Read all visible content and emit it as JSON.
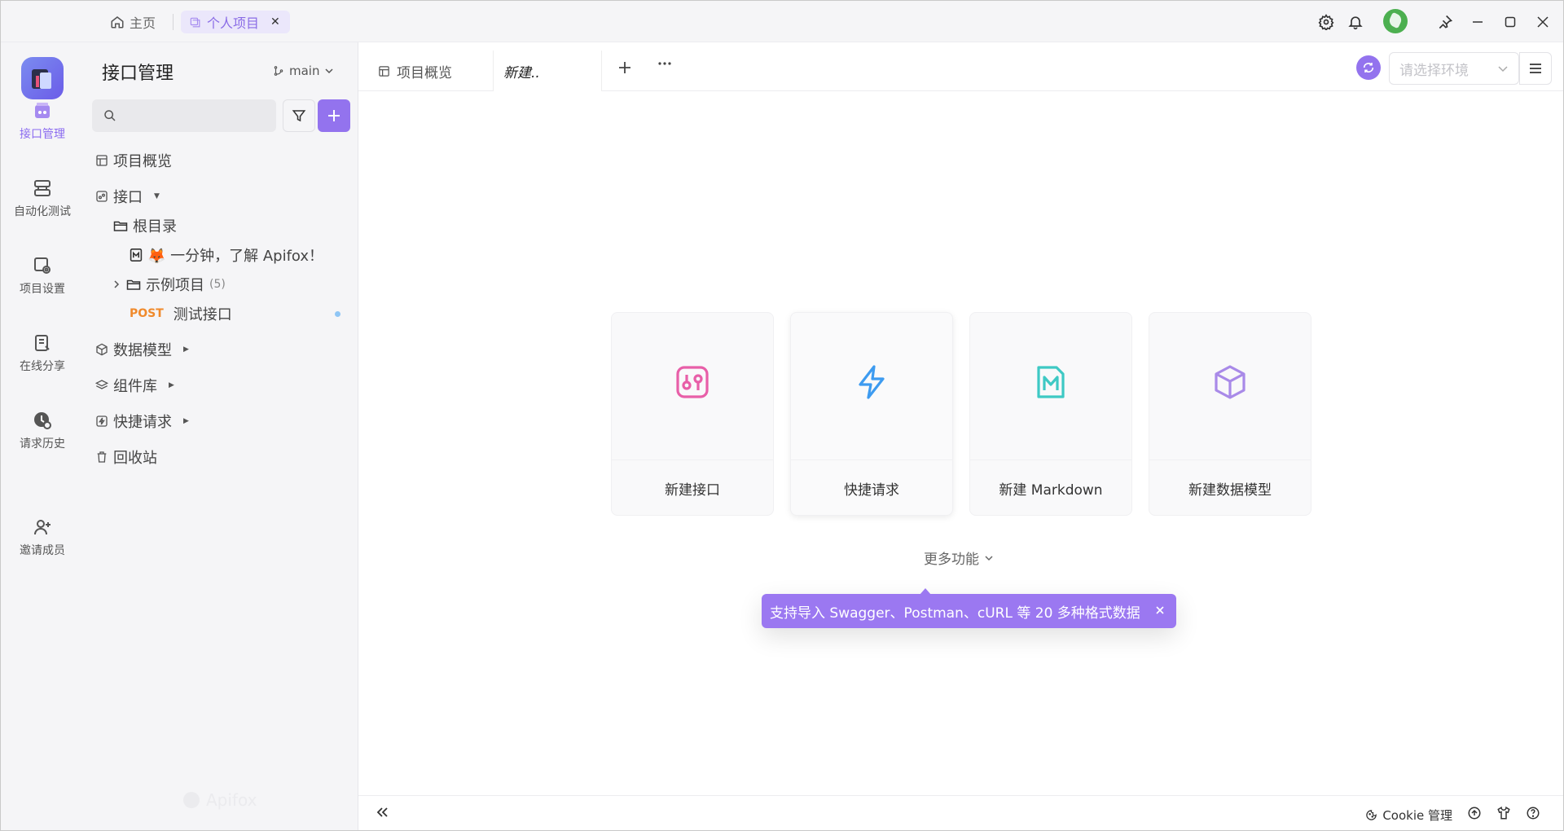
{
  "titlebar": {
    "home_label": "主页",
    "project_tab_label": "个人项目",
    "close_glyph": "✕"
  },
  "rail": {
    "items": [
      {
        "label": "接口管理",
        "icon": "api-manage-icon",
        "active": true
      },
      {
        "label": "自动化测试",
        "icon": "automation-icon",
        "active": false
      },
      {
        "label": "项目设置",
        "icon": "project-settings-icon",
        "active": false
      },
      {
        "label": "在线分享",
        "icon": "online-share-icon",
        "active": false
      },
      {
        "label": "请求历史",
        "icon": "request-history-icon",
        "active": false
      },
      {
        "label": "邀请成员",
        "icon": "invite-member-icon",
        "active": false
      }
    ]
  },
  "sidebar": {
    "title": "接口管理",
    "branch": "main",
    "search_placeholder": "",
    "tree": [
      {
        "label": "项目概览"
      },
      {
        "label": "接口"
      },
      {
        "label": "根目录"
      },
      {
        "label": "🦊 一分钟，了解 Apifox！"
      },
      {
        "label": "示例项目",
        "count": "(5)"
      },
      {
        "method": "POST",
        "label": "测试接口"
      },
      {
        "label": "数据模型"
      },
      {
        "label": "组件库"
      },
      {
        "label": "快捷请求"
      },
      {
        "label": "回收站"
      }
    ],
    "watermark": "Apifox"
  },
  "main": {
    "tabs": [
      {
        "label": "项目概览"
      },
      {
        "label": "新建.."
      }
    ],
    "env_placeholder": "请选择环境",
    "cards": [
      {
        "label": "新建接口",
        "icon": "new-api-icon",
        "color": "#e85fa8"
      },
      {
        "label": "快捷请求",
        "icon": "lightning-icon",
        "color": "#3d9bf0"
      },
      {
        "label": "新建 Markdown",
        "icon": "markdown-icon",
        "color": "#3ec9c4"
      },
      {
        "label": "新建数据模型",
        "icon": "cube-icon",
        "color": "#a98ae8"
      }
    ],
    "more_features": "更多功能",
    "tooltip": "支持导入 Swagger、Postman、cURL 等 20 多种格式数据",
    "status": {
      "cookie_label": "Cookie 管理"
    }
  },
  "colors": {
    "accent": "#9373ee",
    "post_method": "#f08a2c"
  }
}
